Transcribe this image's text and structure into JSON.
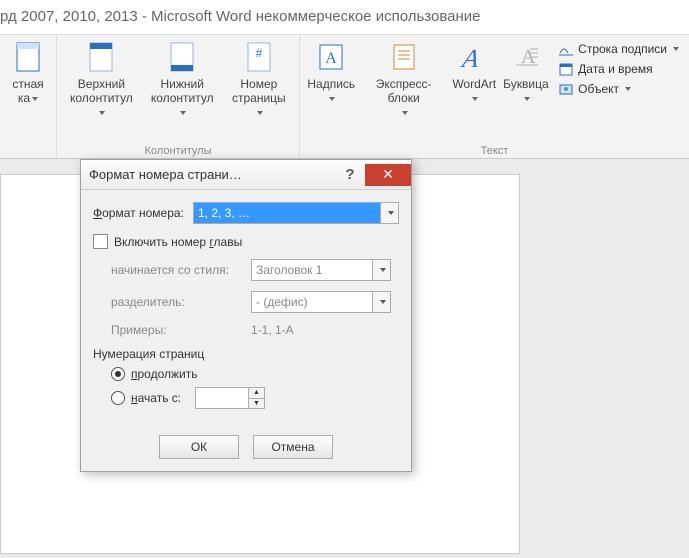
{
  "window": {
    "title": "рд 2007, 2010, 2013  -  Microsoft Word некоммерческое использование"
  },
  "ribbon": {
    "group0": {
      "label": "",
      "item": {
        "line1": "стная",
        "line2": "ка",
        "caret": true
      }
    },
    "group1": {
      "label": "Колонтитулы",
      "header": {
        "line1": "Верхний",
        "line2": "колонтитул",
        "caret": true
      },
      "footer": {
        "line1": "Нижний",
        "line2": "колонтитул",
        "caret": true
      },
      "pagenum": {
        "line1": "Номер",
        "line2": "страницы",
        "caret": true
      }
    },
    "group2": {
      "label": "Текст",
      "textbox": {
        "line1": "Надпись",
        "caret": true
      },
      "quickparts": {
        "line1": "Экспресс-блоки",
        "caret": true
      },
      "wordart": {
        "line1": "WordArt",
        "caret": true
      },
      "dropcap": {
        "line1": "Буквица",
        "caret": true
      },
      "side": {
        "signature": "Строка подписи",
        "datetime": "Дата и время",
        "object": "Объект"
      }
    }
  },
  "dialog": {
    "title": "Формат номера страни…",
    "format_label": "Формат номера:",
    "format_value": "1, 2, 3, …",
    "include_chapter": "Включить номер главы",
    "starts_style_label": "начинается со стиля:",
    "starts_style_value": "Заголовок 1",
    "separator_label": "разделитель:",
    "separator_value": "-   (дефис)",
    "examples_label": "Примеры:",
    "examples_value": "1-1, 1-A",
    "numbering_section": "Нумерация страниц",
    "continue": "продолжить",
    "start_at": "начать с:",
    "ok": "ОК",
    "cancel": "Отмена"
  }
}
